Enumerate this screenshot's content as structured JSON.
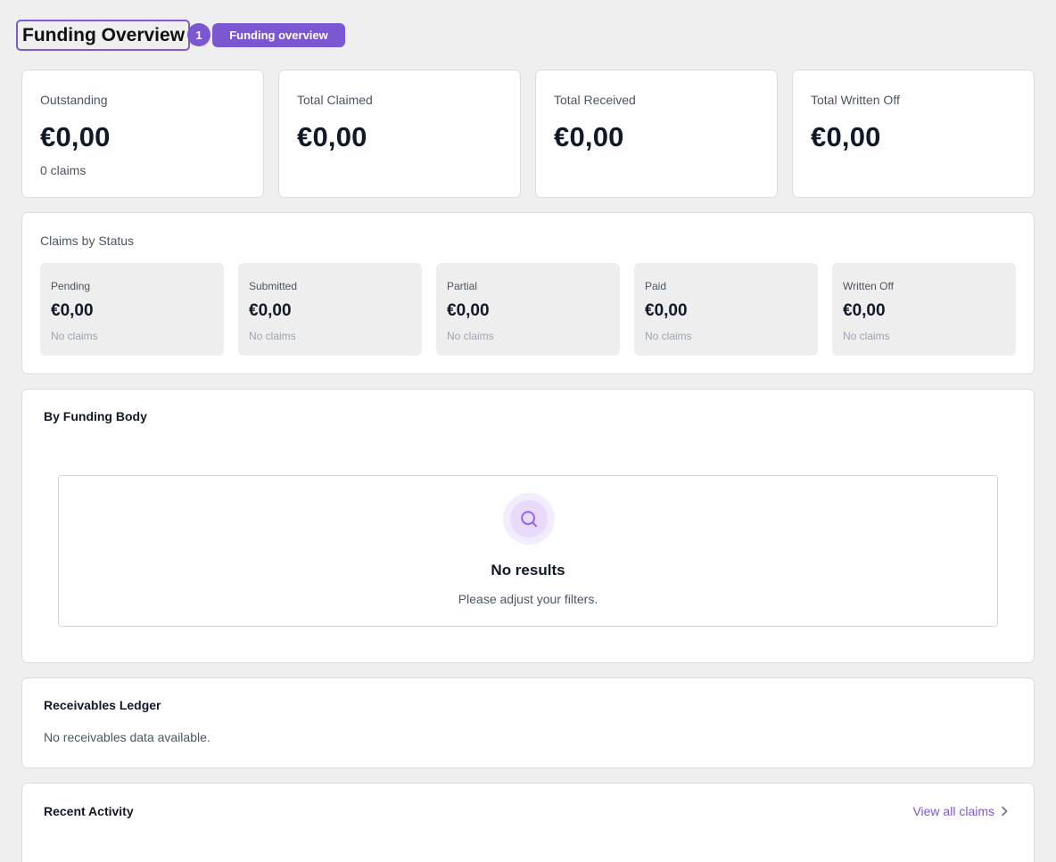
{
  "header": {
    "title": "Funding Overview",
    "step_number": "1",
    "step_label": "Funding overview"
  },
  "stats": [
    {
      "label": "Outstanding",
      "value": "€0,00",
      "sub": "0 claims"
    },
    {
      "label": "Total Claimed",
      "value": "€0,00"
    },
    {
      "label": "Total Received",
      "value": "€0,00"
    },
    {
      "label": "Total Written Off",
      "value": "€0,00"
    }
  ],
  "claims_by_status": {
    "title": "Claims by Status",
    "tiles": [
      {
        "label": "Pending",
        "value": "€0,00",
        "sub": "No claims"
      },
      {
        "label": "Submitted",
        "value": "€0,00",
        "sub": "No claims"
      },
      {
        "label": "Partial",
        "value": "€0,00",
        "sub": "No claims"
      },
      {
        "label": "Paid",
        "value": "€0,00",
        "sub": "No claims"
      },
      {
        "label": "Written Off",
        "value": "€0,00",
        "sub": "No claims"
      }
    ]
  },
  "by_funding_body": {
    "title": "By Funding Body",
    "empty_title": "No results",
    "empty_subtitle": "Please adjust your filters.",
    "empty_icon": "search-icon"
  },
  "receivables_ledger": {
    "title": "Receivables Ledger",
    "empty_text": "No receivables data available."
  },
  "recent_activity": {
    "title": "Recent Activity",
    "view_all_label": "View all claims",
    "view_all_icon": "chevron-right-icon"
  },
  "colors": {
    "accent": "#7b57d1",
    "background": "#efefef",
    "card": "#ffffff",
    "tile": "#eeeeee"
  }
}
